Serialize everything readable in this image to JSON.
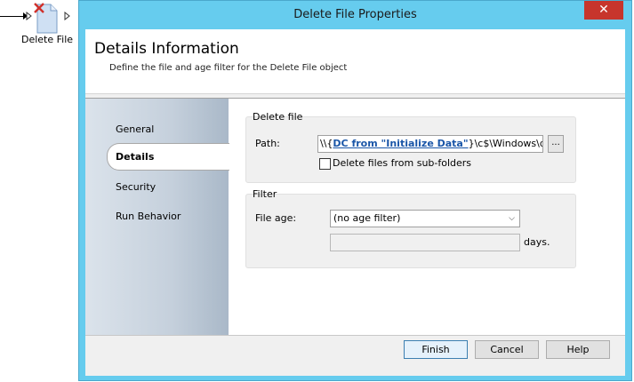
{
  "workflow": {
    "activity_label": "Delete File",
    "icon": "delete-file-icon"
  },
  "dialog": {
    "title": "Delete File Properties",
    "close_glyph": "✕",
    "header": {
      "title": "Details Information",
      "subtitle": "Define the file and age filter for the Delete File object"
    },
    "nav": {
      "items": [
        {
          "label": "General",
          "selected": false
        },
        {
          "label": "Details",
          "selected": true
        },
        {
          "label": "Security",
          "selected": false
        },
        {
          "label": "Run Behavior",
          "selected": false
        }
      ]
    },
    "delete_file": {
      "group_title": "Delete file",
      "path_label": "Path:",
      "path_prefix": "\\\\{",
      "path_link": "DC from \"Initialize Data\"",
      "path_suffix": "}\\c$\\Windows\\debug",
      "browse_label": "...",
      "subfolders_label": "Delete files from sub-folders",
      "subfolders_checked": false
    },
    "filter": {
      "group_title": "Filter",
      "file_age_label": "File age:",
      "file_age_value": "(no age filter)",
      "days_value": "",
      "days_label": "days."
    },
    "buttons": {
      "finish": "Finish",
      "cancel": "Cancel",
      "help": "Help"
    }
  },
  "colors": {
    "titlebar": "#66ccee",
    "close_button": "#c7352c",
    "link": "#1a56a8"
  }
}
